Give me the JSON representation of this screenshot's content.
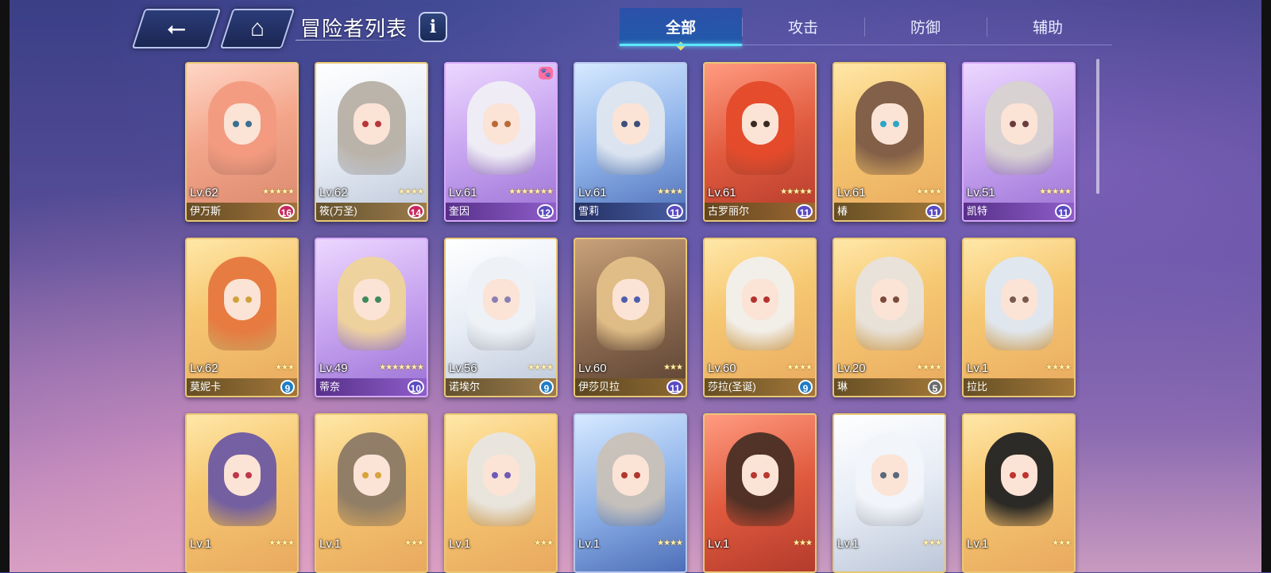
{
  "header": {
    "title": "冒险者列表",
    "info_label": "i",
    "back_icon": "back-arrow-icon",
    "home_icon": "home-icon"
  },
  "tabs": [
    {
      "label": "全部",
      "active": true
    },
    {
      "label": "攻击",
      "active": false
    },
    {
      "label": "防御",
      "active": false
    },
    {
      "label": "辅助",
      "active": false
    }
  ],
  "cards": [
    {
      "level": "Lv.62",
      "name": "伊万斯",
      "stars": "★★★★★",
      "badge": "16",
      "badge_color": "red",
      "theme": "rose",
      "hair": "#f39a7f",
      "eye": "#3b6f8f"
    },
    {
      "level": "Lv.62",
      "name": "筱(万圣)",
      "stars": "★★★★",
      "badge": "14",
      "badge_color": "red",
      "theme": "pale",
      "hair": "#b8b0a6",
      "eye": "#b8373c"
    },
    {
      "level": "Lv.61",
      "name": "奎因",
      "stars": "★★★★★★★",
      "badge": "12",
      "badge_color": "purple",
      "theme": "violet",
      "hair": "#f0eff5",
      "eye": "#b96b3a",
      "paw": "🐾"
    },
    {
      "level": "Lv.61",
      "name": "雪莉",
      "stars": "★★★★",
      "badge": "11",
      "badge_color": "purple",
      "theme": "blue",
      "hair": "#dfe6f0",
      "eye": "#3e4f7c"
    },
    {
      "level": "Lv.61",
      "name": "古罗丽尔",
      "stars": "★★★★★",
      "badge": "11",
      "badge_color": "purple",
      "theme": "red",
      "hair": "#e44a2a",
      "eye": "#3a2a22"
    },
    {
      "level": "Lv.61",
      "name": "椿",
      "stars": "★★★★",
      "badge": "11",
      "badge_color": "purple",
      "theme": "gold",
      "hair": "#7d5a46",
      "eye": "#2ba6c7"
    },
    {
      "level": "Lv.51",
      "name": "凯特",
      "stars": "★★★★★",
      "badge": "11",
      "badge_color": "purple",
      "theme": "violet",
      "hair": "#d8d3d0",
      "eye": "#6b3c3c"
    },
    {
      "level": "Lv.62",
      "name": "莫妮卡",
      "stars": "★★★",
      "badge": "9",
      "badge_color": "teal",
      "theme": "gold",
      "hair": "#e6773e",
      "eye": "#d1a23a"
    },
    {
      "level": "Lv.49",
      "name": "蒂奈",
      "stars": "★★★★★★★",
      "badge": "10",
      "badge_color": "purple",
      "theme": "violet",
      "hair": "#f0d49a",
      "eye": "#3e8a5a"
    },
    {
      "level": "Lv.56",
      "name": "诺埃尔",
      "stars": "★★★★",
      "badge": "9",
      "badge_color": "teal",
      "theme": "pale",
      "hair": "#eef2f7",
      "eye": "#8a7fb0"
    },
    {
      "level": "Lv.60",
      "name": "伊莎贝拉",
      "stars": "★★★",
      "badge": "11",
      "badge_color": "purple",
      "theme": "dark",
      "hair": "#e3c088",
      "eye": "#4e5fae"
    },
    {
      "level": "Lv.60",
      "name": "莎拉(圣诞)",
      "stars": "★★★★",
      "badge": "9",
      "badge_color": "teal",
      "theme": "gold",
      "hair": "#f2f0ee",
      "eye": "#b3342f"
    },
    {
      "level": "Lv.20",
      "name": "琳",
      "stars": "★★★★",
      "badge": "5",
      "badge_color": "gray",
      "theme": "gold",
      "hair": "#e8e3de",
      "eye": "#7a4a3a"
    },
    {
      "level": "Lv.1",
      "name": "拉比",
      "stars": "★★★★",
      "badge": "",
      "badge_color": "gray",
      "theme": "gold",
      "hair": "#dfe8f4",
      "eye": "#7a5a4a"
    },
    {
      "level": "Lv.1",
      "name": "",
      "stars": "★★★★",
      "badge": "",
      "badge_color": "gray",
      "theme": "gold",
      "hair": "#6d5aa3",
      "eye": "#c0374a"
    },
    {
      "level": "Lv.1",
      "name": "",
      "stars": "★★★",
      "badge": "",
      "badge_color": "gray",
      "theme": "gold",
      "hair": "#8c7a66",
      "eye": "#d8a33a"
    },
    {
      "level": "Lv.1",
      "name": "",
      "stars": "★★★",
      "badge": "",
      "badge_color": "gray",
      "theme": "gold",
      "hair": "#e8e6e2",
      "eye": "#6f5ab8"
    },
    {
      "level": "Lv.1",
      "name": "",
      "stars": "★★★★",
      "badge": "",
      "badge_color": "gray",
      "theme": "blue",
      "hair": "#c9c1b8",
      "eye": "#b0372e"
    },
    {
      "level": "Lv.1",
      "name": "",
      "stars": "★★★",
      "badge": "",
      "badge_color": "gray",
      "theme": "red",
      "hair": "#4a2f24",
      "eye": "#b8372e"
    },
    {
      "level": "Lv.1",
      "name": "",
      "stars": "★★★",
      "badge": "",
      "badge_color": "gray",
      "theme": "pale",
      "hair": "#f2f5fa",
      "eye": "#5a6a7c"
    },
    {
      "level": "Lv.1",
      "name": "",
      "stars": "★★★",
      "badge": "",
      "badge_color": "gray",
      "theme": "gold",
      "hair": "#222222",
      "eye": "#c0332f"
    }
  ]
}
